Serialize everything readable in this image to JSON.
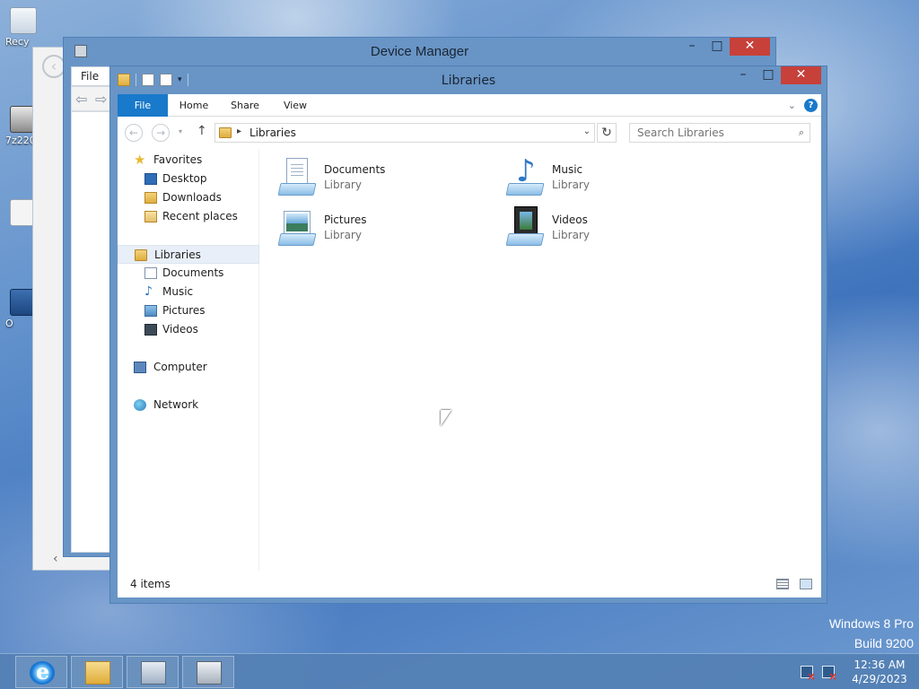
{
  "desktop": {
    "icons": [
      {
        "label": "Recy",
        "icon": "recycle-bin-icon"
      },
      {
        "label": "7z220",
        "icon": "archive-icon"
      },
      {
        "label": "",
        "icon": "document-icon"
      },
      {
        "label": "O",
        "icon": "shortcut-icon"
      }
    ],
    "watermark_line1": "Windows 8 Pro",
    "watermark_line2": "Build 9200"
  },
  "device_manager": {
    "title": "Device Manager",
    "menu_file": "File",
    "minimize": "–",
    "maximize": "□",
    "close": "✕"
  },
  "libraries_window": {
    "title": "Libraries",
    "minimize": "–",
    "maximize": "□",
    "close": "✕",
    "ribbon_tabs": {
      "file": "File",
      "home": "Home",
      "share": "Share",
      "view": "View"
    },
    "help": "?",
    "address_crumb": "Libraries",
    "search_placeholder": "Search Libraries",
    "nav_pane": {
      "favorites": "Favorites",
      "desktop": "Desktop",
      "downloads": "Downloads",
      "recent_places": "Recent places",
      "libraries": "Libraries",
      "documents": "Documents",
      "music": "Music",
      "pictures": "Pictures",
      "videos": "Videos",
      "computer": "Computer",
      "network": "Network"
    },
    "items": [
      {
        "name": "Documents",
        "kind": "Library",
        "icon": "documents-library-icon"
      },
      {
        "name": "Music",
        "kind": "Library",
        "icon": "music-library-icon"
      },
      {
        "name": "Pictures",
        "kind": "Library",
        "icon": "pictures-library-icon"
      },
      {
        "name": "Videos",
        "kind": "Library",
        "icon": "videos-library-icon"
      }
    ],
    "status_count": "4 items"
  },
  "taskbar": {
    "time": "12:36 AM",
    "date": "4/29/2023"
  },
  "colors": {
    "ribbon_file_tab": "#1979ca",
    "window_frame": "#6895c6",
    "close_button": "#c7403a"
  }
}
